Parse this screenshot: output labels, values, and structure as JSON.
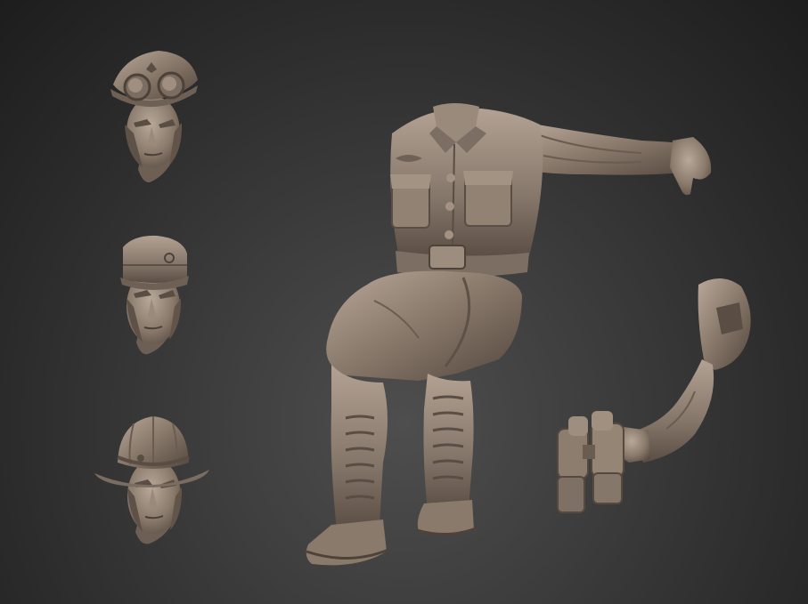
{
  "scene": {
    "background_color": "#3a3a3a",
    "clay_color": "#8a7a6c",
    "clay_highlight": "#b7a697",
    "clay_shadow": "#4e4239",
    "parts": [
      "head-officer-cap-goggles",
      "head-field-cap",
      "head-pith-helmet",
      "seated-torso-legs-boots",
      "arm-with-binoculars"
    ]
  }
}
